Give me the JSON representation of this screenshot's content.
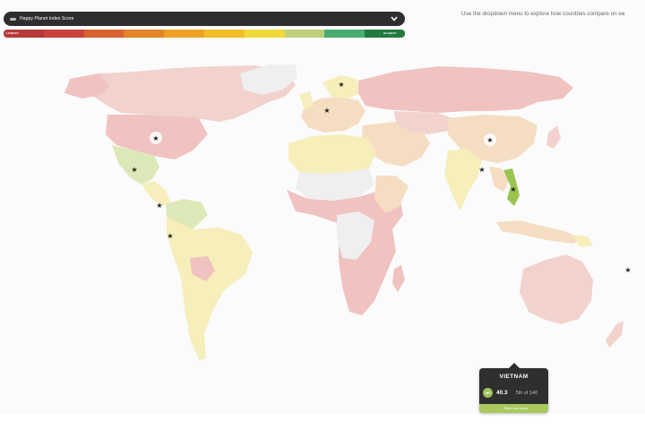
{
  "header": {
    "dropdown_label": "Happy Planet Index Score",
    "dropdown_icon": "chevron-down-icon"
  },
  "legend": {
    "low_label": "LOWEST",
    "high_label": "HIGHEST",
    "colors": [
      "#b73a3a",
      "#c9433b",
      "#d9622f",
      "#e38527",
      "#eca324",
      "#f1bd28",
      "#efd93a",
      "#bdd07a",
      "#46ad6f",
      "#217a3e"
    ]
  },
  "hint_text": "Use the dropdown menu to explore how  countries compare on ea",
  "map": {
    "colors": {
      "ocean": "#fbfbfb",
      "pale_red": "#f0c2c0",
      "light_pink": "#f2d2cc",
      "peach": "#f5ddc2",
      "light_yellow": "#f6eebb",
      "pale_green": "#dde8b8",
      "no_data": "#efefef",
      "highlight_green": "#9ac44e"
    },
    "star_icon": "star-icon"
  },
  "tooltip": {
    "country": "VIETNAM",
    "badge": "HPI",
    "score": "40.3",
    "rank": "5th of 140",
    "footer": "→ Read case study"
  }
}
